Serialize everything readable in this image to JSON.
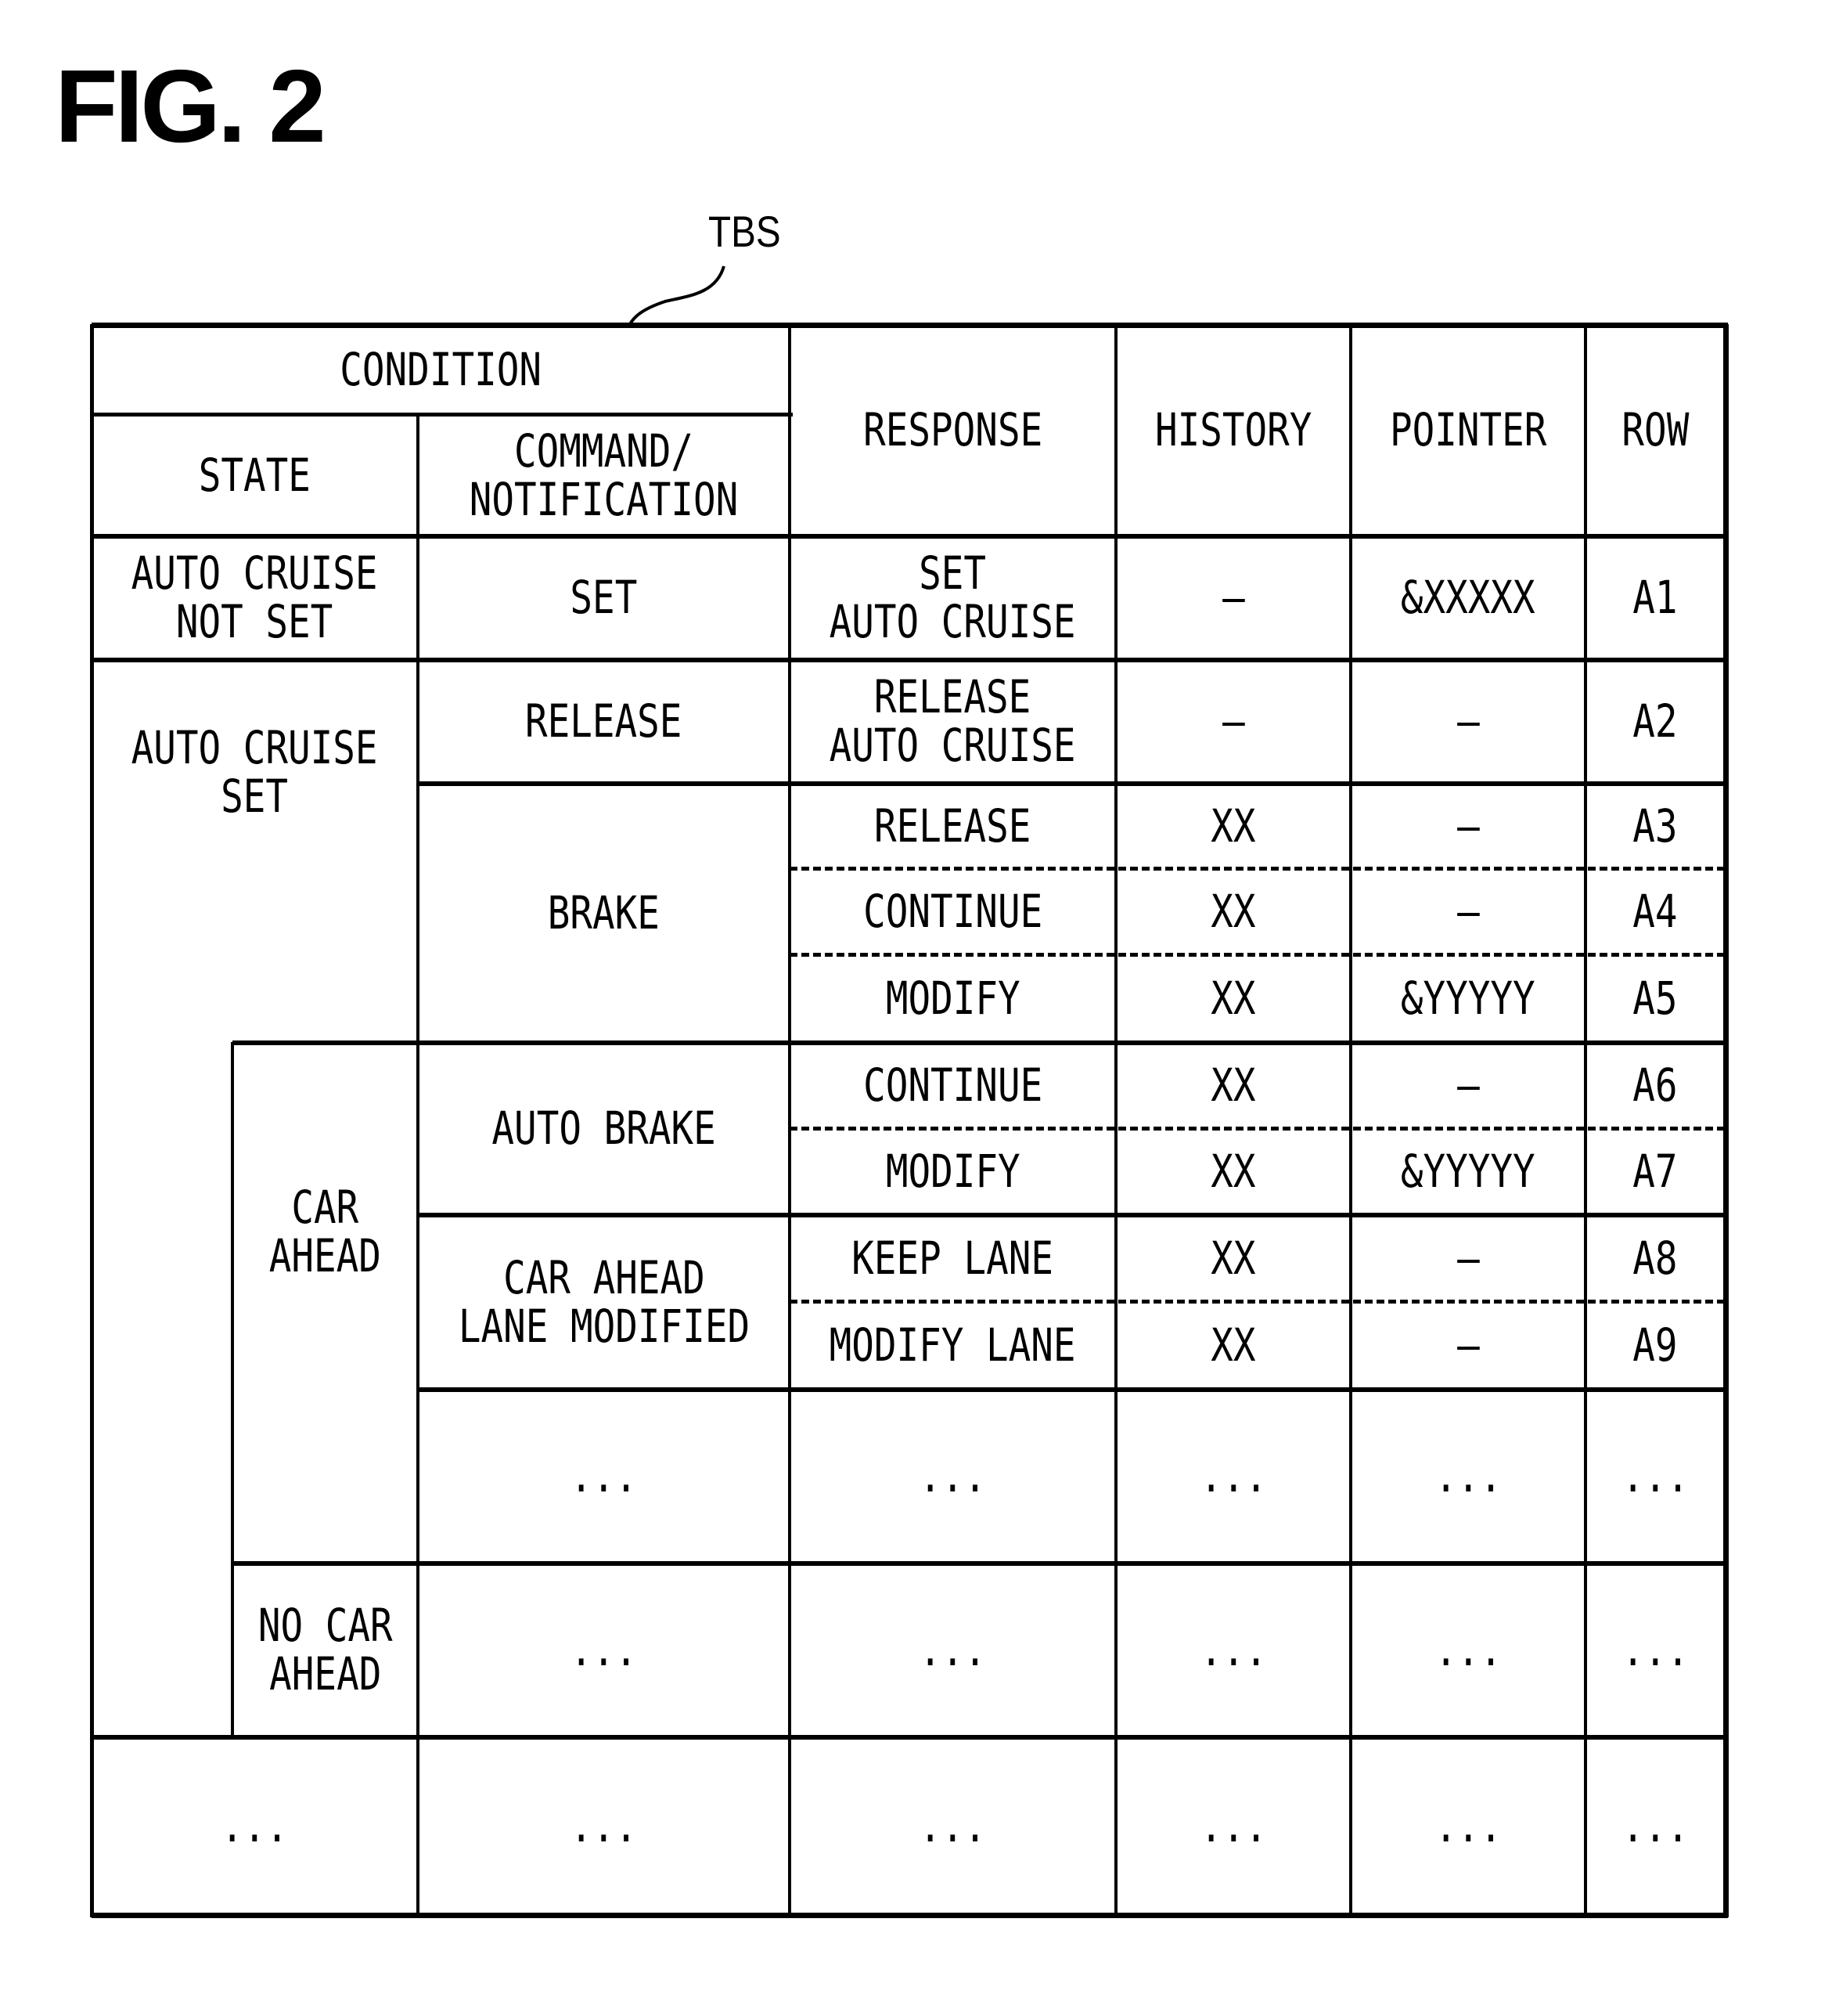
{
  "figure": {
    "title": "FIG. 2",
    "reference_label": "TBS"
  },
  "table": {
    "headers": {
      "condition": "CONDITION",
      "state": "STATE",
      "command": "COMMAND/\nNOTIFICATION",
      "response": "RESPONSE",
      "history": "HISTORY",
      "pointer": "POINTER",
      "row": "ROW"
    },
    "states": {
      "not_set": "AUTO CRUISE\nNOT SET",
      "set": "AUTO CRUISE\nSET",
      "car_ahead": "CAR\nAHEAD",
      "no_car_ahead": "NO CAR\nAHEAD",
      "ellipsis": "..."
    },
    "commands": {
      "set": "SET",
      "release": "RELEASE",
      "brake": "BRAKE",
      "auto_brake": "AUTO BRAKE",
      "lane_modified": "CAR AHEAD\nLANE MODIFIED",
      "ellipsis": "..."
    },
    "rows": [
      {
        "response": "SET\nAUTO CRUISE",
        "history": "—",
        "pointer": "&XXXXX",
        "row": "A1"
      },
      {
        "response": "RELEASE\nAUTO CRUISE",
        "history": "—",
        "pointer": "—",
        "row": "A2"
      },
      {
        "response": "RELEASE",
        "history": "XX",
        "pointer": "—",
        "row": "A3"
      },
      {
        "response": "CONTINUE",
        "history": "XX",
        "pointer": "—",
        "row": "A4"
      },
      {
        "response": "MODIFY",
        "history": "XX",
        "pointer": "&YYYYY",
        "row": "A5"
      },
      {
        "response": "CONTINUE",
        "history": "XX",
        "pointer": "—",
        "row": "A6"
      },
      {
        "response": "MODIFY",
        "history": "XX",
        "pointer": "&YYYYY",
        "row": "A7"
      },
      {
        "response": "KEEP LANE",
        "history": "XX",
        "pointer": "—",
        "row": "A8"
      },
      {
        "response": "MODIFY LANE",
        "history": "XX",
        "pointer": "—",
        "row": "A9"
      },
      {
        "response": "...",
        "history": "...",
        "pointer": "...",
        "row": "..."
      },
      {
        "response": "...",
        "history": "...",
        "pointer": "...",
        "row": "..."
      },
      {
        "response": "...",
        "history": "...",
        "pointer": "...",
        "row": "..."
      }
    ]
  }
}
